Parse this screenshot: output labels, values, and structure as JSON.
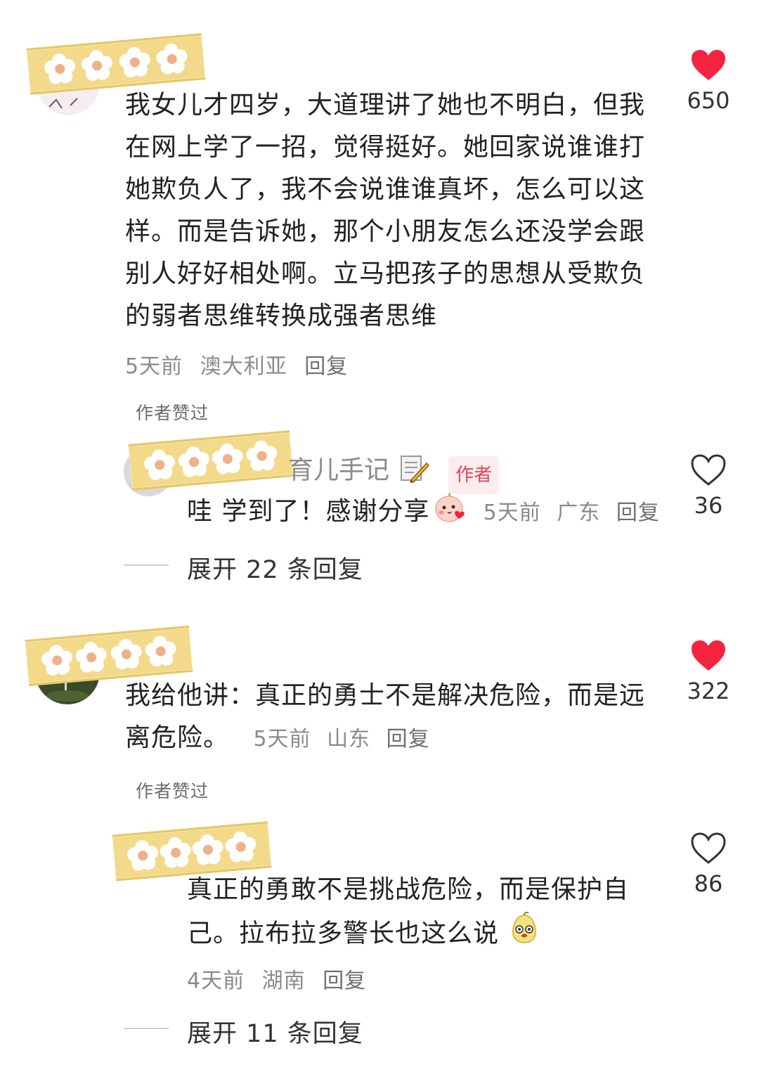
{
  "comments": [
    {
      "text": "我女儿才四岁，大道理讲了她也不明白，但我在网上学了一招，觉得挺好。她回家说谁谁打她欺负人了，我不会说谁谁真坏，怎么可以这样。而是告诉她，那个小朋友怎么还没学会跟别人好好相处啊。立马把孩子的思想从受欺负的弱者思维转换成强者思维",
      "time": "5天前",
      "location": "澳大利亚",
      "reply_label": "回复",
      "likes": "650",
      "liked": true,
      "author_liked": "作者赞过",
      "reply": {
        "username": "育儿手记",
        "badge": "作者",
        "text": "哇 学到了！感谢分享",
        "time": "5天前",
        "location": "广东",
        "reply_label": "回复",
        "likes": "36"
      },
      "expand": "展开 22 条回复"
    },
    {
      "text": "我给他讲：真正的勇士不是解决危险，而是远离危险。",
      "time": "5天前",
      "location": "山东",
      "reply_label": "回复",
      "likes": "322",
      "liked": true,
      "author_liked": "作者赞过",
      "reply": {
        "text": "真正的勇敢不是挑战危险，而是保护自己。拉布拉多警长也这么说",
        "time": "4天前",
        "location": "湖南",
        "reply_label": "回复",
        "likes": "86"
      },
      "expand": "展开 11 条回复"
    }
  ],
  "colors": {
    "liked_heart": "#f5233f",
    "tape": "#f3d98a",
    "author_badge": "#e0455c"
  },
  "icons": {
    "liked": "heart-filled-icon",
    "unliked": "heart-outline-icon"
  }
}
